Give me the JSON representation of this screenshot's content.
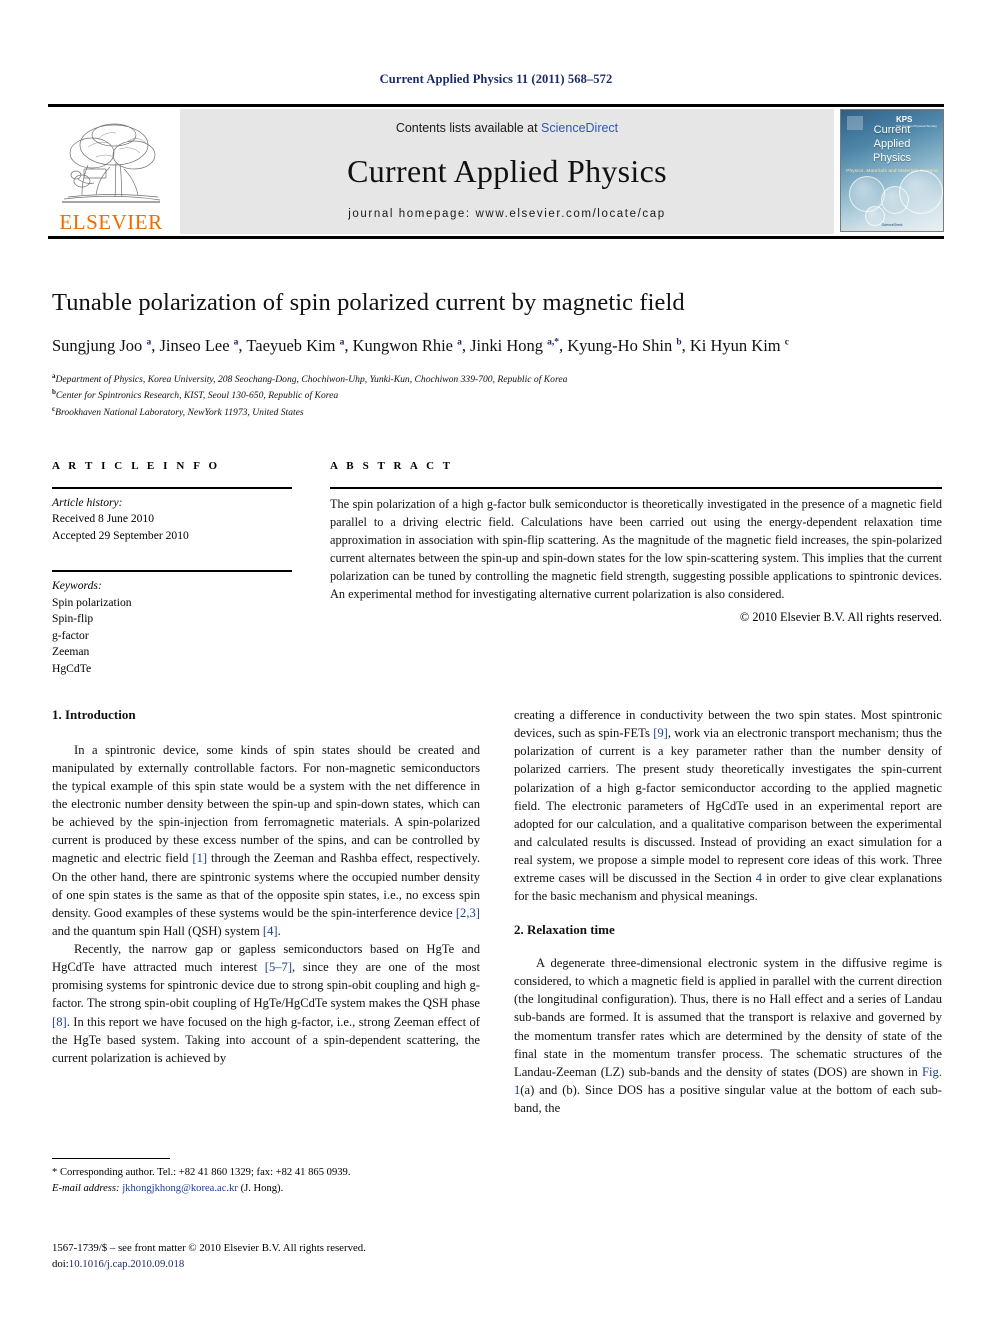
{
  "running_head": "Current Applied Physics 11 (2011) 568–572",
  "masthead": {
    "contents_prefix": "Contents lists available at ",
    "sciencedirect": "ScienceDirect",
    "journal_title": "Current Applied Physics",
    "homepage": "journal homepage: www.elsevier.com/locate/cap",
    "publisher_wordmark": "ELSEVIER",
    "cover": {
      "line1": "Current",
      "line2": "Applied",
      "line3": "Physics",
      "subtitle": "Physics, Materials and Materials Science",
      "society": "KPS",
      "society_sub": "The Korean Physical Society",
      "footer": "ScienceDirect"
    }
  },
  "article": {
    "title": "Tunable polarization of spin polarized current by magnetic field",
    "authors_html": "Sungjung Joo <sup>a</sup>, Jinseo Lee <sup>a</sup>, Taeyueb Kim <sup>a</sup>, Kungwon Rhie <sup>a</sup>, Jinki Hong <sup>a,*</sup>, Kyung-Ho Shin <sup>b</sup>, Ki Hyun Kim <sup>c</sup>",
    "affiliations": [
      "Department of Physics, Korea University, 208 Seochang-Dong, Chochiwon-Uhp, Yunki-Kun, Chochiwon 339-700, Republic of Korea",
      "Center for Spintronics Research, KIST, Seoul 130-650, Republic of Korea",
      "Brookhaven National Laboratory, NewYork 11973, United States"
    ],
    "affil_marks": [
      "a",
      "b",
      "c"
    ]
  },
  "info": {
    "article_info_heading": "A R T I C L E    I N F O",
    "abstract_heading": "A B S T R A C T",
    "history_label": "Article history:",
    "history_lines": [
      "Received 8 June 2010",
      "Accepted 29 September 2010"
    ],
    "keywords_label": "Keywords:",
    "keywords": [
      "Spin polarization",
      "Spin-flip",
      "g-factor",
      "Zeeman",
      "HgCdTe"
    ]
  },
  "abstract": {
    "text": "The spin polarization of a high g-factor bulk semiconductor is theoretically investigated in the presence of a magnetic field parallel to a driving electric field. Calculations have been carried out using the energy-dependent relaxation time approximation in association with spin-flip scattering. As the magnitude of the magnetic field increases, the spin-polarized current alternates between the spin-up and spin-down states for the low spin-scattering system. This implies that the current polarization can be tuned by controlling the magnetic field strength, suggesting possible applications to spintronic devices. An experimental method for investigating alternative current polarization is also considered.",
    "copyright": "© 2010 Elsevier B.V. All rights reserved."
  },
  "body": {
    "section1_heading": "1.  Introduction",
    "section2_heading": "2.  Relaxation time",
    "left_para1_a": "In a spintronic device, some kinds of spin states should be created and manipulated by externally controllable factors. For non-magnetic semiconductors the typical example of this spin state would be a system with the net difference in the electronic number density between the spin-up and spin-down states, which can be achieved by the spin-injection from ferromagnetic materials. A spin-polarized current is produced by these excess number of the spins, and can be controlled by magnetic and electric field ",
    "left_para1_ref1": "[1]",
    "left_para1_b": " through the Zeeman and Rashba effect, respectively. On the other hand, there are spintronic systems where the occupied number density of one spin states is the same as that of the opposite spin states, i.e., no excess spin density. Good examples of these systems would be the spin-interference device ",
    "left_para1_ref2": "[2,3]",
    "left_para1_c": " and the quantum spin Hall (QSH) system ",
    "left_para1_ref3": "[4]",
    "left_para1_d": ".",
    "left_para2_a": "Recently, the narrow gap or gapless semiconductors based on HgTe and HgCdTe have attracted much interest ",
    "left_para2_ref1": "[5–7]",
    "left_para2_b": ", since they are one of the most promising systems for spintronic device due to strong spin-obit coupling and high g-factor. The strong spin-obit coupling of HgTe/HgCdTe system makes the QSH phase ",
    "left_para2_ref2": "[8]",
    "left_para2_c": ". In this report we have focused on the high g-factor, i.e., strong Zeeman effect of the HgTe based system. Taking into account of a spin-dependent scattering, the current polarization is achieved by",
    "right_para1_a": "creating a difference in conductivity between the two spin states. Most spintronic devices, such as spin-FETs ",
    "right_para1_ref1": "[9]",
    "right_para1_b": ", work via an electronic transport mechanism; thus the polarization of current is a key parameter rather than the number density of polarized carriers. The present study theoretically investigates the spin-current polarization of a high g-factor semiconductor according to the applied magnetic field. The electronic parameters of HgCdTe used in an experimental report are adopted for our calculation, and a qualitative comparison between the experimental and calculated results is discussed. Instead of providing an exact simulation for a real system, we propose a simple model to represent core ideas of this work. Three extreme cases will be discussed in the Section ",
    "right_para1_ref2": "4",
    "right_para1_c": " in order to give clear explanations for the basic mechanism and physical meanings.",
    "right_para2_a": "A degenerate three-dimensional electronic system in the diffusive regime is considered, to which a magnetic field is applied in parallel with the current direction (the longitudinal configuration). Thus, there is no Hall effect and a series of Landau sub-bands are formed. It is assumed that the transport is relaxive and governed by the momentum transfer rates which are determined by the density of state of the final state in the momentum transfer process. The schematic structures of the Landau-Zeeman (LZ) sub-bands and the density of states (DOS) are shown in ",
    "right_para2_ref1": "Fig. 1",
    "right_para2_b": "(a) and (b). Since DOS has a positive singular value at the bottom of each sub-band, the"
  },
  "footnotes": {
    "corresponding": "* Corresponding author. Tel.: +82 41 860 1329; fax: +82 41 865 0939.",
    "email_label": "E-mail address:",
    "email": "jkhongjkhong@korea.ac.kr",
    "email_suffix": "(J. Hong)."
  },
  "footer": {
    "issn_line": "1567-1739/$ – see front matter © 2010 Elsevier B.V. All rights reserved.",
    "doi_prefix": "doi:",
    "doi": "10.1016/j.cap.2010.09.018"
  },
  "colors": {
    "link_blue": "#2b57b8",
    "ref_blue": "#1b3f94",
    "running_head_blue": "#1b2a6b",
    "elsevier_orange": "#F06C00",
    "masthead_grey": "#e6e6e6"
  }
}
